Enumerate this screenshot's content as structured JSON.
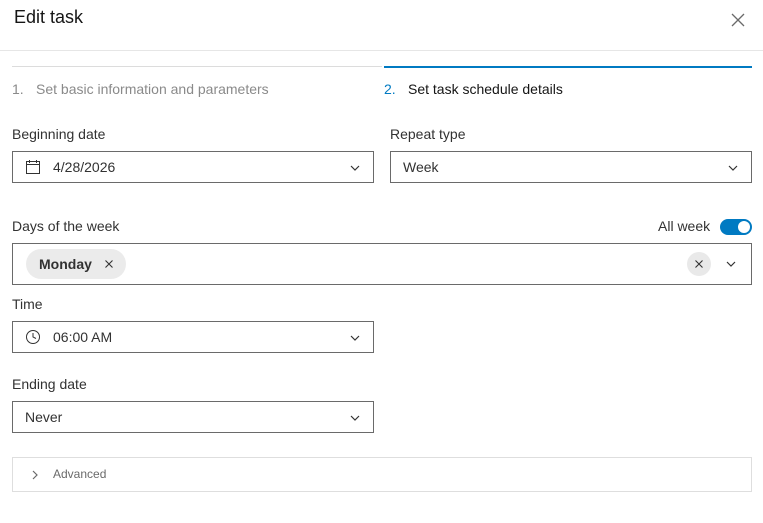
{
  "dialog": {
    "title": "Edit task",
    "close_icon": "close-icon"
  },
  "steps": [
    {
      "number": "1.",
      "label": "Set basic information and parameters",
      "active": false
    },
    {
      "number": "2.",
      "label": "Set task schedule details",
      "active": true
    }
  ],
  "colors": {
    "accent": "#007ac2",
    "border": "#6a6a6a",
    "inactive_text": "#8a8a8a"
  },
  "form": {
    "beginning_date": {
      "label": "Beginning date",
      "value": "4/28/2026",
      "icon": "calendar-icon"
    },
    "repeat_type": {
      "label": "Repeat type",
      "value": "Week"
    },
    "days_of_week": {
      "label": "Days of the week",
      "all_week_label": "All week",
      "all_week_on": true,
      "selected": [
        "Monday"
      ]
    },
    "time": {
      "label": "Time",
      "value": "06:00 AM",
      "icon": "clock-icon"
    },
    "ending_date": {
      "label": "Ending date",
      "value": "Never"
    },
    "advanced": {
      "label": "Advanced",
      "expanded": false
    }
  }
}
